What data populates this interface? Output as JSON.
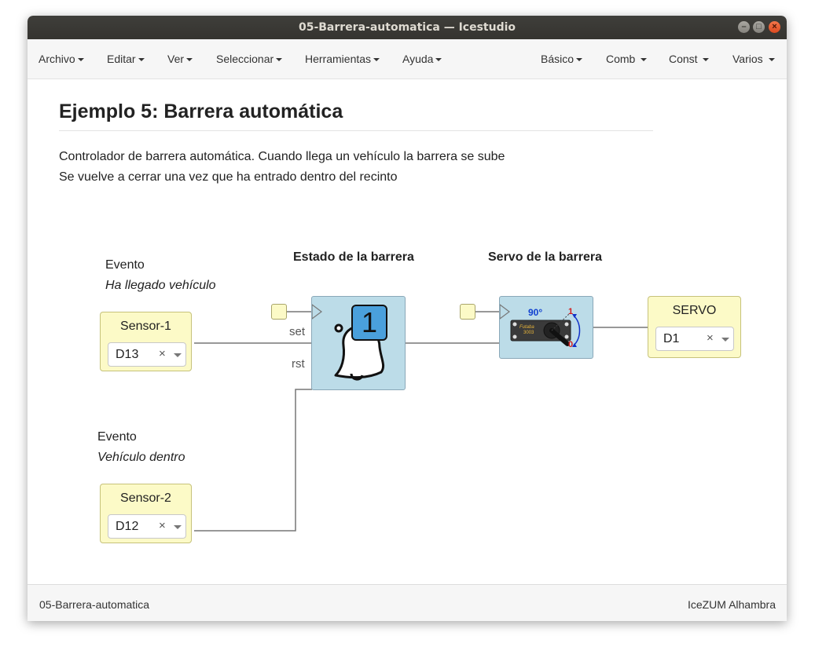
{
  "window": {
    "title": "05-Barrera-automatica — Icestudio"
  },
  "menubar": {
    "left": [
      "Archivo",
      "Editar",
      "Ver",
      "Seleccionar",
      "Herramientas",
      "Ayuda"
    ],
    "right": [
      "Básico",
      "Comb",
      "Const",
      "Varios"
    ]
  },
  "document": {
    "heading": "Ejemplo 5: Barrera automática",
    "description_lines": [
      "Controlador de barrera automática. Cuando llega un vehículo la barrera se sube",
      "Se vuelve a cerrar una vez que ha entrado dentro del recinto"
    ]
  },
  "circuit": {
    "comment1": {
      "line1": "Evento",
      "line2": "Ha llegado vehículo"
    },
    "comment2": {
      "line1": "Evento",
      "line2": "Vehículo dentro"
    },
    "state_title": "Estado de la barrera",
    "servo_title": "Servo de la barrera",
    "inputs": [
      {
        "name": "Sensor-1",
        "pin": "D13"
      },
      {
        "name": "Sensor-2",
        "pin": "D12"
      }
    ],
    "output": {
      "name": "SERVO",
      "pin": "D1"
    },
    "flipflop": {
      "value": "1",
      "ports": [
        "set",
        "rst"
      ]
    },
    "servo_icon": {
      "angle_label": "90°",
      "pos_high": "1",
      "pos_low": "0",
      "brand_line1": "Futaba",
      "brand_line2": "3003"
    },
    "clear_symbol": "×"
  },
  "statusbar": {
    "left": "05-Barrera-automatica",
    "right": "IceZUM Alhambra"
  },
  "colors": {
    "io_block": "#fcfac7",
    "func_block": "#bcdce8",
    "flipflop_digit_bg": "#4aa0dc",
    "close_button": "#e4562a"
  }
}
